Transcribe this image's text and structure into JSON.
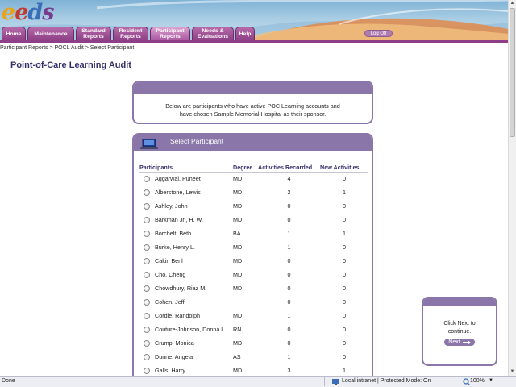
{
  "header": {
    "logo_letters": [
      {
        "ch": "e",
        "color": "#e8a21c"
      },
      {
        "ch": "e",
        "color": "#c33a2e"
      },
      {
        "ch": "d",
        "color": "#3a6fb8"
      },
      {
        "ch": "s",
        "color": "#7a3a8a"
      }
    ],
    "logo_tm": "™",
    "logout_label": "Log Off",
    "tabs": [
      {
        "label": "Home",
        "width": 30,
        "active": false
      },
      {
        "label": "Maintenance",
        "width": 58,
        "active": false
      },
      {
        "label": "Standard\nReports",
        "width": 44,
        "active": false
      },
      {
        "label": "Resident\nReports",
        "width": 44,
        "active": false
      },
      {
        "label": "Participant\nReports",
        "width": 50,
        "active": true
      },
      {
        "label": "Needs &\nEvaluations",
        "width": 52,
        "active": false
      },
      {
        "label": "Help",
        "width": 24,
        "active": false
      }
    ]
  },
  "breadcrumb": "Participant Reports > POCL Audit > Select Participant",
  "page_title": "Point-of-Care Learning Audit",
  "intro_text_1": "Below are participants who have active POC Learning accounts and",
  "intro_text_2": "have chosen Sample Memorial Hospital as their sponsor.",
  "select_title": "Select Participant",
  "columns": [
    "Participants",
    "Degree",
    "Activities Recorded",
    "New Activities"
  ],
  "participants": [
    [
      "Aggarwal, Puneet",
      "MD",
      "4",
      "0"
    ],
    [
      "Alberstone, Lewis",
      "MD",
      "2",
      "1"
    ],
    [
      "Ashley, John",
      "MD",
      "0",
      "0"
    ],
    [
      "Barkman Jr., H. W.",
      "MD",
      "0",
      "0"
    ],
    [
      "Borchelt, Beth",
      "BA",
      "1",
      "1"
    ],
    [
      "Burke, Henry L.",
      "MD",
      "1",
      "0"
    ],
    [
      "Cakir, Beril",
      "MD",
      "0",
      "0"
    ],
    [
      "Cho, Cheng",
      "MD",
      "0",
      "0"
    ],
    [
      "Chowdhury, Riaz M.",
      "MD",
      "0",
      "0"
    ],
    [
      "Cohen, Jeff",
      "",
      "0",
      "0"
    ],
    [
      "Cordle, Randolph",
      "MD",
      "1",
      "0"
    ],
    [
      "Couture-Johnson, Donna L.",
      "RN",
      "0",
      "0"
    ],
    [
      "Crump, Monica",
      "MD",
      "0",
      "0"
    ],
    [
      "Dunne, Angela",
      "AS",
      "1",
      "0"
    ],
    [
      "Galls, Harry",
      "MD",
      "3",
      "1"
    ]
  ],
  "next_msg_1": "Click Next to",
  "next_msg_2": "continue.",
  "next_label": "Next",
  "status": {
    "done": "Done",
    "zone": "Local intranet | Protected Mode: On",
    "zoom": "100%"
  }
}
